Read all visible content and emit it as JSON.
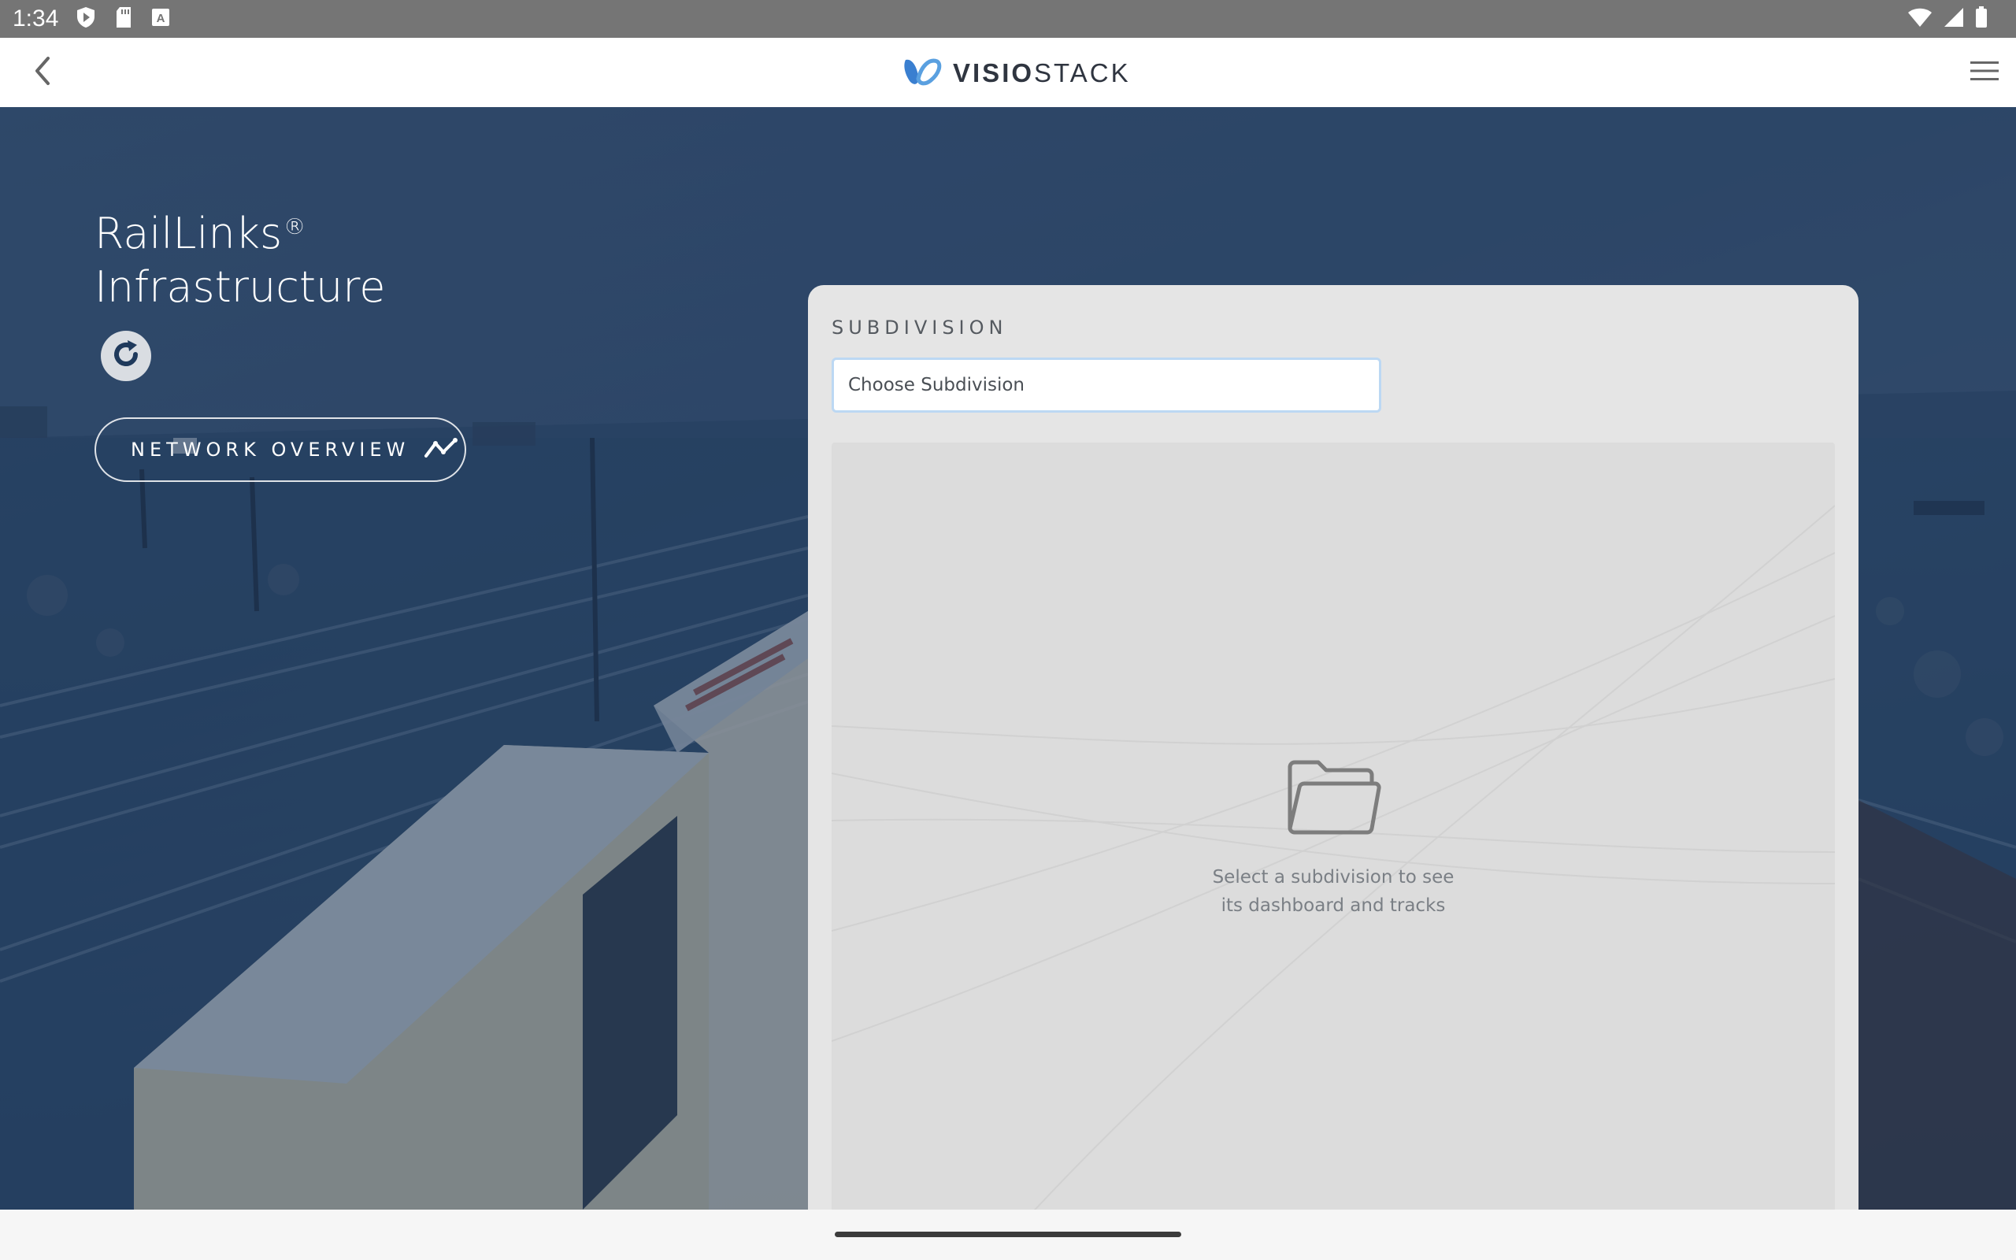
{
  "status_bar": {
    "time": "1:34",
    "icons": [
      "play-protect-icon",
      "sd-card-icon",
      "keyboard-a-icon",
      "wifi-icon",
      "signal-icon",
      "battery-icon"
    ]
  },
  "app_bar": {
    "brand_strong": "VISIO",
    "brand_light": "STACK",
    "icons": [
      "back-arrow-icon",
      "visiostack-logo-icon",
      "hamburger-menu-icon"
    ]
  },
  "hero": {
    "title_line1": "RailLinks",
    "title_reg": "®",
    "title_line2": "Infrastructure",
    "network_overview_label": "NETWORK OVERVIEW"
  },
  "panel": {
    "section_label": "SUBDIVISION",
    "subdivision_placeholder": "Choose Subdivision",
    "subdivision_value": "",
    "empty_line1": "Select a subdivision to see",
    "empty_line2": "its dashboard and tracks"
  },
  "colors": {
    "status_bar": "#757575",
    "hero_overlay": "#1f3a5c",
    "panel_bg": "#e5e5e5",
    "input_border": "#bcd8f3",
    "logo_blue": "#3a7fd0"
  }
}
